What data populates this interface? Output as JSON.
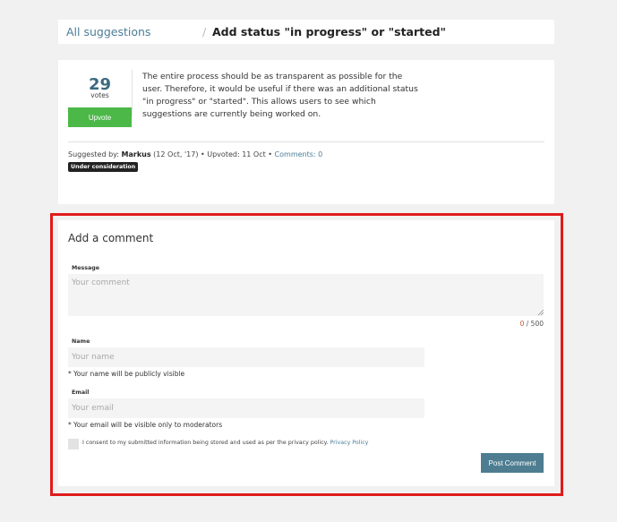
{
  "breadcrumb": {
    "link": "All suggestions",
    "separator": "/",
    "title": "Add status \"in progress\" or \"started\""
  },
  "suggestion": {
    "votes": "29",
    "votes_label": "votes",
    "upvote_label": "Upvote",
    "description": "The entire process should be as transparent as possible for the user. Therefore, it would be useful if there was an additional status \"in progress\" or \"started\". This allows users to see which suggestions are currently being worked on.",
    "meta": {
      "prefix": "Suggested by: ",
      "author": "Markus",
      "details": " (12 Oct, '17) • Upvoted: 11 Oct • ",
      "comments_link": "Comments: 0"
    },
    "status_badge": "Under consideration"
  },
  "comment_form": {
    "heading": "Add a comment",
    "message": {
      "label": "Message",
      "placeholder": "Your comment",
      "value": ""
    },
    "counter": {
      "current": "0",
      "max": "/ 500"
    },
    "name": {
      "label": "Name",
      "placeholder": "Your name",
      "value": "",
      "note": "* Your name will be publicly visible"
    },
    "email": {
      "label": "Email",
      "placeholder": "Your email",
      "value": "",
      "note": "* Your email will be visible only to moderators"
    },
    "consent": {
      "text": "I consent to my submitted information being stored and used as per the privacy policy. ",
      "link": "Privacy Policy",
      "checked": false
    },
    "submit_label": "Post Comment"
  },
  "colors": {
    "accent_link": "#4a7d97",
    "upvote_green": "#4cb848",
    "post_button": "#4e7d91",
    "highlight_border": "#e01b1b",
    "counter_zero": "#d0542e"
  },
  "icons": {
    "textarea_resize": "resize-grip-icon"
  }
}
